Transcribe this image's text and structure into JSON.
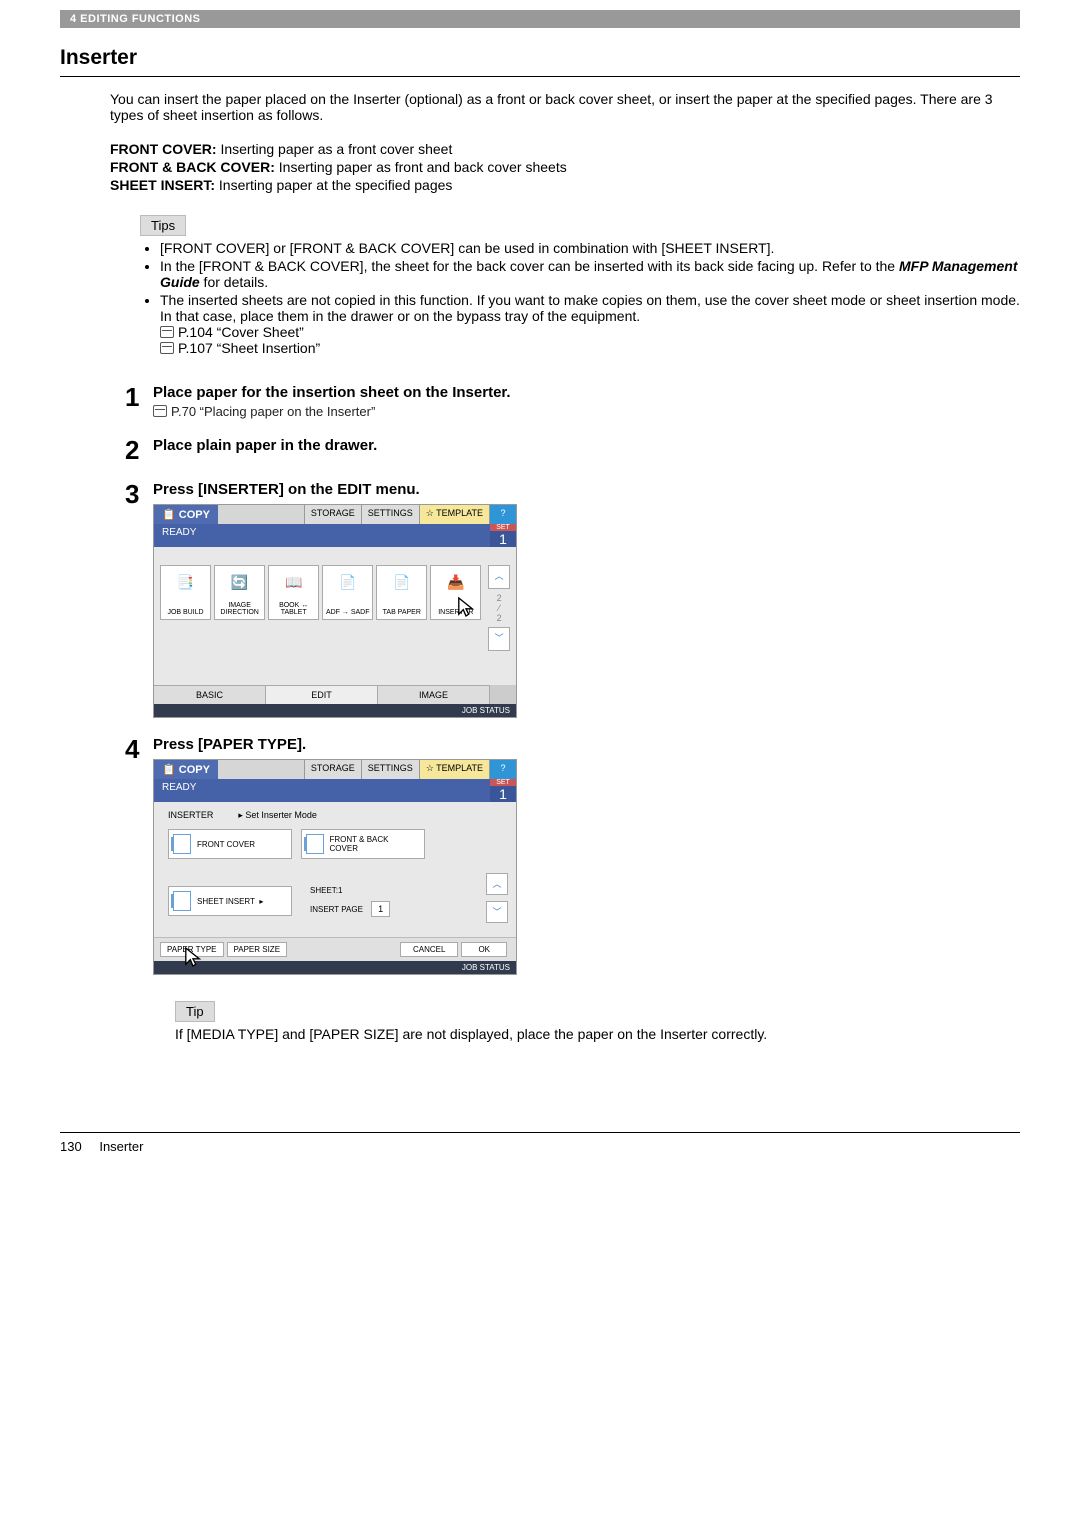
{
  "header": {
    "chapter": "4 EDITING FUNCTIONS"
  },
  "section_title": "Inserter",
  "intro": "You can insert the paper placed on the Inserter (optional) as a front or back cover sheet, or insert the paper at the specified pages. There are 3 types of sheet insertion as follows.",
  "definitions": [
    {
      "term": "FRONT COVER:",
      "desc": " Inserting paper as a front cover sheet"
    },
    {
      "term": "FRONT & BACK COVER:",
      "desc": " Inserting paper as front and back cover sheets"
    },
    {
      "term": "SHEET INSERT:",
      "desc": " Inserting paper at the specified pages"
    }
  ],
  "tips_header": "Tips",
  "tips": {
    "items": [
      "[FRONT COVER] or [FRONT & BACK COVER] can be used in combination with [SHEET INSERT].",
      "In the [FRONT & BACK COVER], the sheet for the back cover can be inserted with its back side facing up. Refer to the MFP Management Guide for details.",
      "The inserted sheets are not copied in this function. If you want to make copies on them, use the cover sheet mode or sheet insertion mode. In that case, place them in the drawer or on the bypass tray of the equipment."
    ],
    "refs": [
      "P.104 “Cover Sheet”",
      "P.107 “Sheet Insertion”"
    ]
  },
  "steps": [
    {
      "num": "1",
      "title": "Place paper for the insertion sheet on the Inserter.",
      "ref": "P.70 “Placing paper on the Inserter”"
    },
    {
      "num": "2",
      "title": "Place plain paper in the drawer."
    },
    {
      "num": "3",
      "title": "Press [INSERTER] on the EDIT menu."
    },
    {
      "num": "4",
      "title": "Press [PAPER TYPE]."
    }
  ],
  "screen1": {
    "top": {
      "copy": "COPY",
      "storage": "STORAGE",
      "settings": "SETTINGS",
      "template": "TEMPLATE",
      "help": "?"
    },
    "status": {
      "ready": "READY",
      "set": "SET",
      "count": "1"
    },
    "functions": [
      {
        "label": "JOB BUILD"
      },
      {
        "label": "IMAGE\nDIRECTION"
      },
      {
        "label": "BOOK ↔\nTABLET"
      },
      {
        "label": "ADF →\nSADF"
      },
      {
        "label": "TAB\nPAPER"
      },
      {
        "label": "INSERTER"
      }
    ],
    "page_ind_top": "2",
    "page_ind_bot": "2",
    "low_tabs": {
      "basic": "BASIC",
      "edit": "EDIT",
      "image": "IMAGE"
    },
    "job_status": "JOB STATUS"
  },
  "screen2": {
    "top": {
      "copy": "COPY",
      "storage": "STORAGE",
      "settings": "SETTINGS",
      "template": "TEMPLATE",
      "help": "?"
    },
    "status": {
      "ready": "READY",
      "set": "SET",
      "count": "1"
    },
    "inserter_label": "INSERTER",
    "inserter_hint": "▸ Set Inserter Mode",
    "front_cover": "FRONT COVER",
    "front_back": "FRONT & BACK\nCOVER",
    "sheet_insert": "SHEET INSERT",
    "sheet1": "SHEET:1",
    "insert_page": "INSERT PAGE",
    "insert_val": "1",
    "paper_type": "PAPER TYPE",
    "paper_size": "PAPER SIZE",
    "cancel": "CANCEL",
    "ok": "OK",
    "job_status": "JOB STATUS"
  },
  "tip2": {
    "header": "Tip",
    "text": "If [MEDIA TYPE] and [PAPER SIZE] are not displayed, place the paper on the Inserter correctly."
  },
  "footer": {
    "page": "130",
    "title": "Inserter"
  }
}
